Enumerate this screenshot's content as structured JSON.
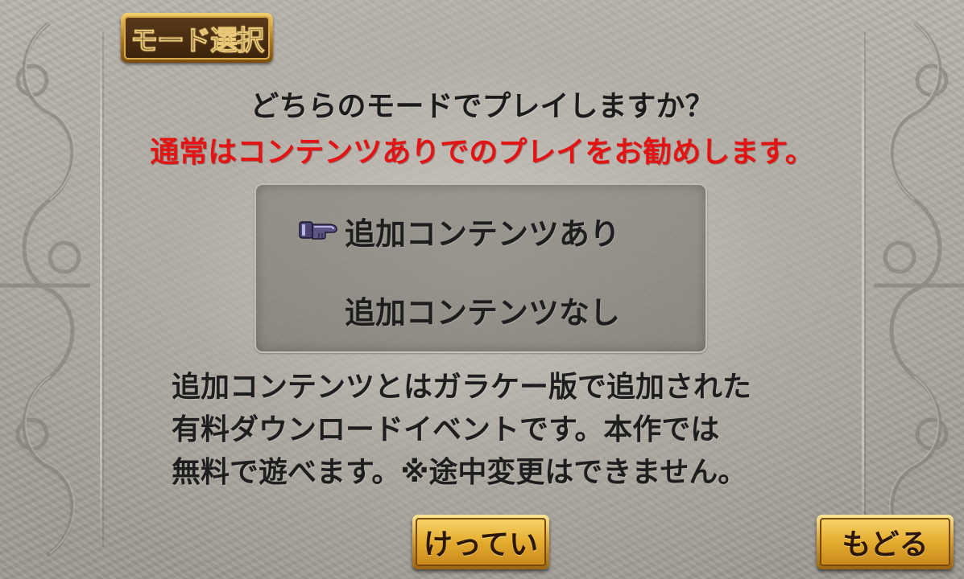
{
  "header": {
    "mode_title": "モード選択"
  },
  "dialog": {
    "question": "どちらのモードでプレイしますか？",
    "recommendation": "通常はコンテンツありでのプレイをお勧めします。",
    "options": [
      {
        "label": "追加コンテンツあり",
        "selected": true
      },
      {
        "label": "追加コンテンツなし",
        "selected": false
      }
    ],
    "description_lines": [
      "追加コンテンツとはガラケー版で追加された",
      "有料ダウンロードイベントです。本作では",
      "無料で遊べます。※途中変更はできません。"
    ]
  },
  "buttons": {
    "confirm_label": "けってい",
    "back_label": "もどる"
  },
  "colors": {
    "recommend_text": "#e31414",
    "button_gold": "#e4ac2f",
    "text": "#1e1e1e"
  },
  "icons": {
    "cursor": "gauntlet-pointer-icon"
  }
}
